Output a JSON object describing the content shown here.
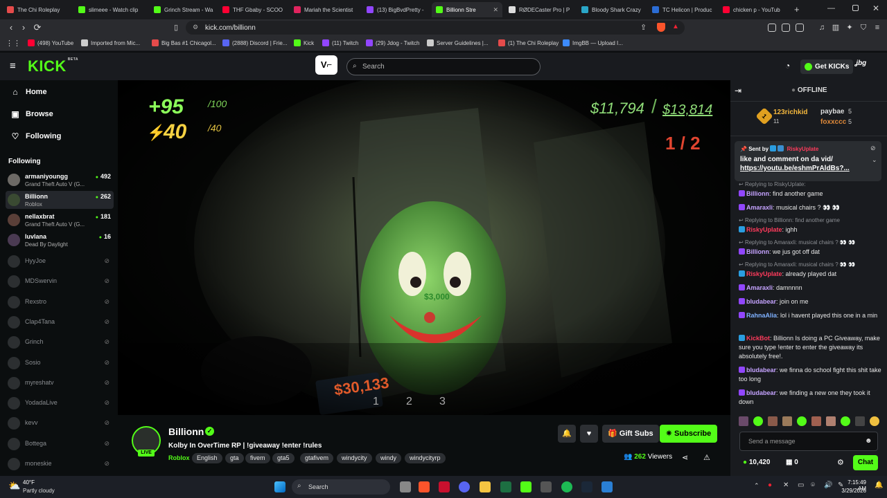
{
  "browser": {
    "tabs": [
      {
        "title": "The Chi Roleplay",
        "color": "#e54b4b"
      },
      {
        "title": "slimeee - Watch clip",
        "color": "#53fc18"
      },
      {
        "title": "Grinch Stream - Wa",
        "color": "#53fc18"
      },
      {
        "title": "THF Gbaby - SCOO",
        "color": "#ff0033"
      },
      {
        "title": "Mariah the Scientist",
        "color": "#e0245e"
      },
      {
        "title": "(13) BigBvdPretty -",
        "color": "#9146ff"
      },
      {
        "title": "Billionn Stre",
        "color": "#53fc18",
        "active": true
      },
      {
        "title": "RØDECaster Pro | P",
        "color": "#dddddd"
      },
      {
        "title": "Bloody Shark Crazy",
        "color": "#2aa6c7"
      },
      {
        "title": "TC Helicon | Produc",
        "color": "#2b6cd4"
      },
      {
        "title": "chicken p - YouTub",
        "color": "#ff0033"
      }
    ],
    "url": "kick.com/billionn",
    "bookmarks": [
      {
        "label": "(498) YouTube",
        "color": "#ff0033"
      },
      {
        "label": "Imported from Mic...",
        "color": "#cccccc"
      },
      {
        "label": "Big Bas #1 Chicagol...",
        "color": "#e54b4b"
      },
      {
        "label": "(2888) Discord | Frie...",
        "color": "#5865f2"
      },
      {
        "label": "Kick",
        "color": "#53fc18"
      },
      {
        "label": "(11) Twitch",
        "color": "#9146ff"
      },
      {
        "label": "(29) Jdog - Twitch",
        "color": "#9146ff"
      },
      {
        "label": "Server Guidelines |...",
        "color": "#cccccc"
      },
      {
        "label": "(1) The Chi Roleplay",
        "color": "#e54b4b"
      },
      {
        "label": "ImgBB — Upload I...",
        "color": "#3d8bfd"
      }
    ]
  },
  "header": {
    "logo": "KICK",
    "logo_beta": "BETA",
    "search_placeholder": "Search",
    "get_kicks": "Get KICKs"
  },
  "sidebar": {
    "nav": [
      {
        "label": "Home",
        "icon": "home-icon"
      },
      {
        "label": "Browse",
        "icon": "browse-icon"
      },
      {
        "label": "Following",
        "icon": "heart-icon"
      }
    ],
    "following_heading": "Following",
    "live": [
      {
        "name": "armaniyoungg",
        "game": "Grand Theft Auto V (G...",
        "viewers": "492"
      },
      {
        "name": "Billionn",
        "game": "Roblox",
        "viewers": "262",
        "selected": true
      },
      {
        "name": "nellaxbrat",
        "game": "Grand Theft Auto V (G...",
        "viewers": "181"
      },
      {
        "name": "luvlana",
        "game": "Dead By Daylight",
        "viewers": "16"
      }
    ],
    "offline": [
      "HyyJoe",
      "MDSwervin",
      "Rexstro",
      "Clap4Tana",
      "Grinch",
      "Sosio",
      "myreshatv",
      "YodadaLive",
      "kevv",
      "Bottega",
      "moneskie"
    ]
  },
  "video": {
    "health": "+95",
    "health_max": "/100",
    "stamina": "40",
    "stamina_max": "/40",
    "money_current": "$11,794",
    "money_target": "$13,814",
    "round": "1 / 2",
    "center_price": "$3,000",
    "bottom_price": "$30,133",
    "slots": [
      "1",
      "2",
      "3"
    ]
  },
  "channel": {
    "name": "Billionn",
    "live": "LIVE",
    "title": "Kolby In OverTime RP | !giveaway !enter !rules",
    "category": "Roblox",
    "tags": [
      "English",
      "gta",
      "fivem",
      "gta5",
      "gtafivem",
      "windycity",
      "windy",
      "windycityrp"
    ],
    "gift_subs": "Gift Subs",
    "subscribe": "Subscribe",
    "viewers_count": "262",
    "viewers_label": "Viewers"
  },
  "chat": {
    "status": "OFFLINE",
    "leaderboard": {
      "first_name": "123richkid",
      "first_score": "11",
      "rank": "1",
      "second": [
        {
          "name": "paybae",
          "score": "5"
        },
        {
          "name": "foxxccc",
          "score": "5"
        }
      ]
    },
    "pinned": {
      "sent_by": "Sent by",
      "user": "RiskyUpIate",
      "text": "like and comment on da vid/",
      "link": "https://youtu.be/eshmPrAldBs?..."
    },
    "messages": [
      {
        "reply": "Replying to RiskyUpIate:",
        "user": "Billionn",
        "color": "#c5a3ff",
        "text": "find another game"
      },
      {
        "user": "Amaraxli",
        "color": "#c5a3ff",
        "text": "musical chairs ? 👀 👀"
      },
      {
        "reply": "Replying to Billionn: find another game",
        "user": "RiskyUpIate",
        "color": "#ff3b5c",
        "text": "ighh"
      },
      {
        "reply": "Replying to Amaraxli: musical chairs ? 👀 👀",
        "user": "Billionn",
        "color": "#c5a3ff",
        "text": "we jus got off dat"
      },
      {
        "reply": "Replying to Amaraxli: musical chairs ? 👀 👀",
        "user": "RiskyUpIate",
        "color": "#ff3b5c",
        "text": "already played dat"
      },
      {
        "user": "Amaraxli",
        "color": "#c5a3ff",
        "text": "damnnnn"
      },
      {
        "user": "bludabear",
        "color": "#c5a3ff",
        "text": "join on me"
      },
      {
        "user": "RahnaAlia",
        "color": "#7fb1ff",
        "text": "lol i havent played this one in a min"
      },
      {
        "user": "KickBot",
        "color": "#ff3b5c",
        "text": "Billionn Is doing a PC Giveaway, make sure you type !enter to enter the giveaway its absolutely free!."
      },
      {
        "user": "bludabear",
        "color": "#c5a3ff",
        "text": "we finna do school fight this shit take too long"
      },
      {
        "user": "bludabear",
        "color": "#c5a3ff",
        "text": "we finding a new one they took it down"
      }
    ],
    "input_placeholder": "Send a message",
    "kicks_balance": "10,420",
    "gifts_count": "0",
    "chat_button": "Chat"
  },
  "taskbar": {
    "weather_temp": "40°F",
    "weather_desc": "Partly cloudy",
    "search_label": "Search",
    "time": "7:15:49 AM",
    "date": "3/29/2026"
  }
}
